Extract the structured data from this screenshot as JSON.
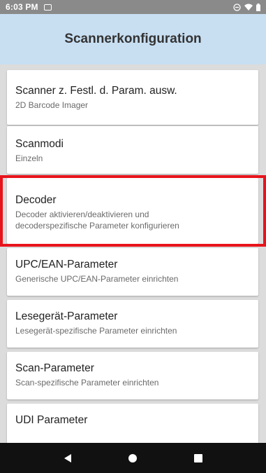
{
  "status_bar": {
    "time": "6:03 PM",
    "icons": [
      "image-notification-icon",
      "do-not-disturb-icon",
      "wifi-icon",
      "battery-icon"
    ]
  },
  "app_bar": {
    "title": "Scannerkonfiguration"
  },
  "settings": {
    "items": [
      {
        "title": "Scanner z. Festl. d. Param. ausw.",
        "subtitle": "2D Barcode Imager"
      },
      {
        "title": "Scanmodi",
        "subtitle": "Einzeln"
      },
      {
        "title": "Decoder",
        "subtitle_line1": "Decoder aktivieren/deaktivieren und",
        "subtitle_line2": "decoderspezifische Parameter konfigurieren"
      },
      {
        "title": "UPC/EAN-Parameter",
        "subtitle": "Generische UPC/EAN-Parameter einrichten"
      },
      {
        "title": "Lesegerät-Parameter",
        "subtitle": "Lesegerät-spezifische Parameter einrichten"
      },
      {
        "title": "Scan-Parameter",
        "subtitle": "Scan-spezifische Parameter einrichten"
      },
      {
        "title": "UDI Parameter"
      }
    ]
  },
  "highlight": {
    "color": "#e8141c",
    "target": "Decoder"
  },
  "navigation": {
    "buttons": [
      "back-icon",
      "home-icon",
      "recents-icon"
    ]
  },
  "colors": {
    "status_bar": "#8a8a8a",
    "app_bar": "#c8dff2",
    "list_background": "#dcdcdc",
    "nav_bar": "#111111"
  }
}
